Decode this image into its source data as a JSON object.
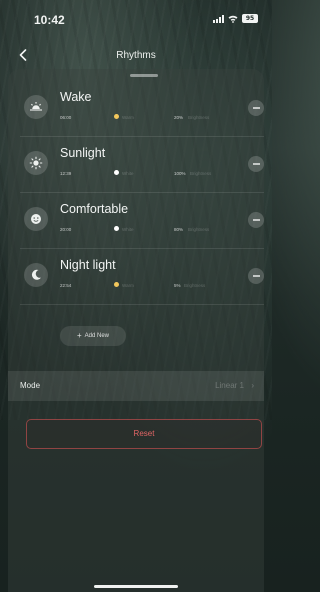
{
  "status_bar": {
    "time": "10:42",
    "battery": "95"
  },
  "nav": {
    "title": "Rhythms"
  },
  "rhythms": [
    {
      "title": "Wake",
      "time": "06:00",
      "color_label": "Warm",
      "dot_color": "#f2c75c",
      "brightness": "20%",
      "brightness_label": "Brightness",
      "icon": "sunrise-icon"
    },
    {
      "title": "Sunlight",
      "time": "12:39",
      "color_label": "White",
      "dot_color": "#ffffff",
      "brightness": "100%",
      "brightness_label": "Brightness",
      "icon": "sun-icon"
    },
    {
      "title": "Comfortable",
      "time": "20:00",
      "color_label": "White",
      "dot_color": "#ffffff",
      "brightness": "80%",
      "brightness_label": "Brightness",
      "icon": "comfort-icon"
    },
    {
      "title": "Night light",
      "time": "22:54",
      "color_label": "Warm",
      "dot_color": "#f2c75c",
      "brightness": "5%",
      "brightness_label": "Brightness",
      "icon": "moon-icon"
    }
  ],
  "add_new": {
    "label": "Add New"
  },
  "mode": {
    "label": "Mode",
    "value": "Linear 1"
  },
  "reset": {
    "label": "Reset"
  },
  "colors": {
    "accent_reset": "#e06565",
    "warm_dot": "#f2c75c"
  }
}
